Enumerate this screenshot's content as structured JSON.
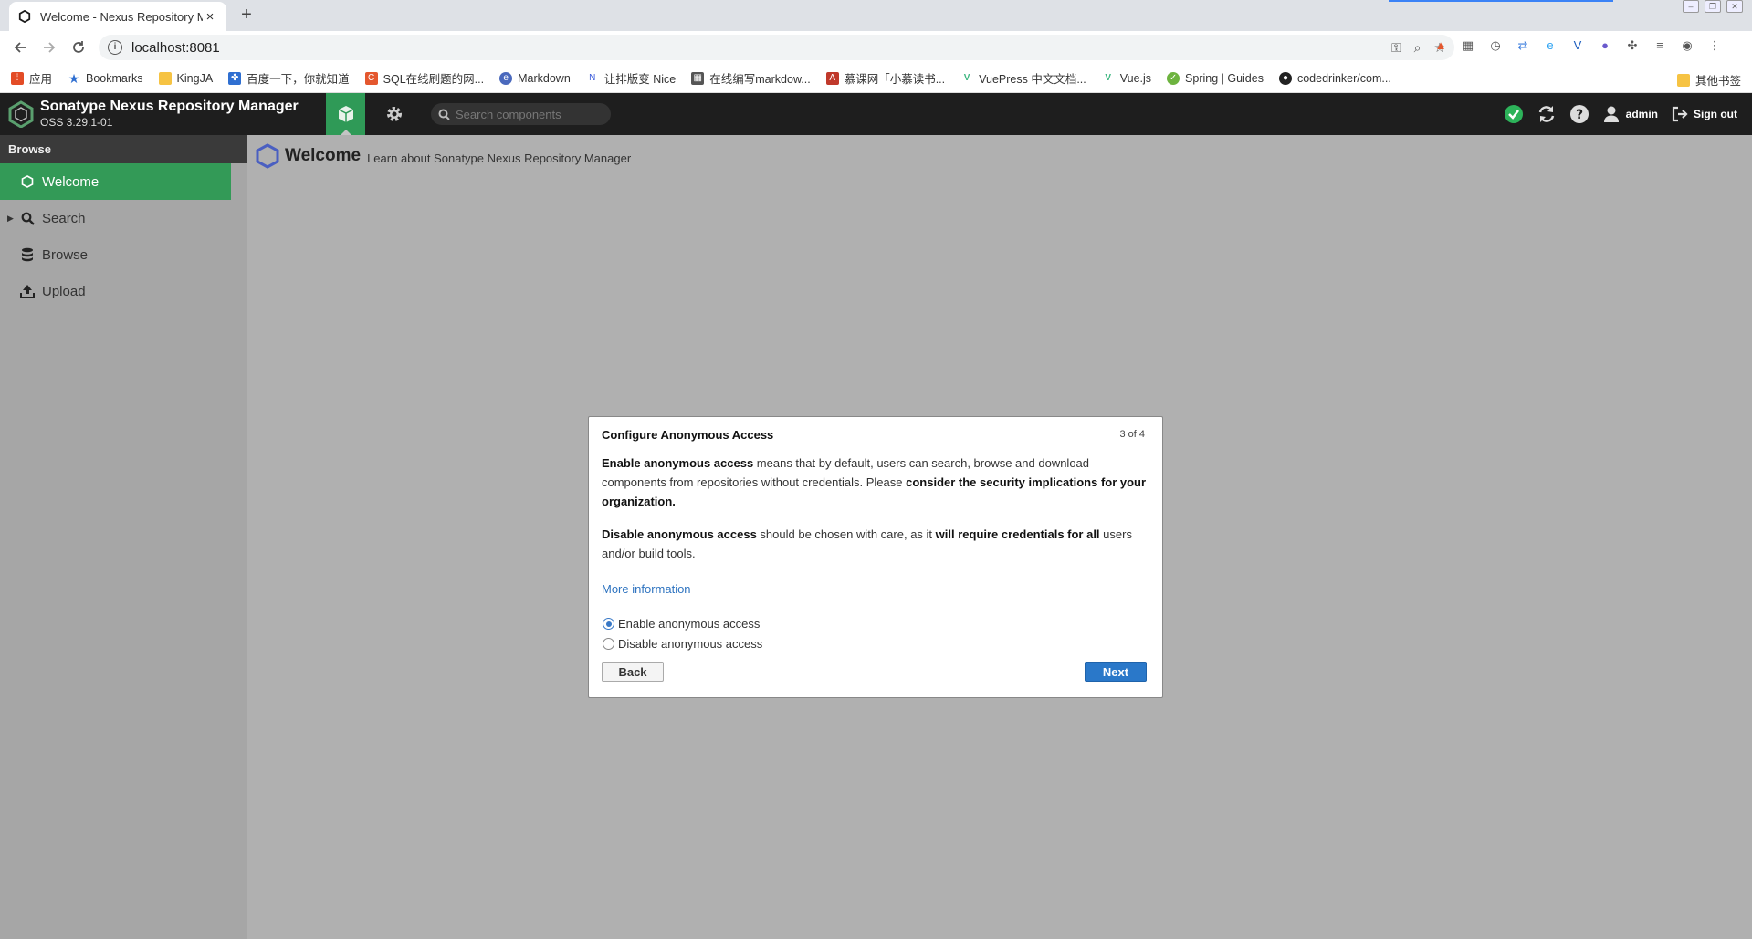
{
  "browser": {
    "tab_title": "Welcome - Nexus Repository M",
    "new_tab_label": "+",
    "tab_close_label": "×",
    "url": "localhost:8081",
    "bookmarks": [
      {
        "label": "应用",
        "icon": "apps-icon",
        "color": "#e34c26"
      },
      {
        "label": "Bookmarks",
        "icon": "star-icon",
        "color": "#2f6fd1"
      },
      {
        "label": "KingJA",
        "icon": "folder-icon",
        "color": "#f6c343"
      },
      {
        "label": "百度一下，你就知道",
        "icon": "baidu-icon",
        "color": "#2f6fd1"
      },
      {
        "label": "SQL在线刷题的网...",
        "icon": "sql-icon",
        "color": "#e4572e"
      },
      {
        "label": "Markdown",
        "icon": "markdown-icon",
        "color": "#4a69bd"
      },
      {
        "label": "让排版变 Nice",
        "icon": "nice-icon",
        "color": "#3b5bdb"
      },
      {
        "label": "在线编写markdow...",
        "icon": "qr-icon",
        "color": "#555555"
      },
      {
        "label": "慕课网「小慕读书...",
        "icon": "imooc-icon",
        "color": "#c0392b"
      },
      {
        "label": "VuePress 中文文档...",
        "icon": "vue-icon",
        "color": "#41b883"
      },
      {
        "label": "Vue.js",
        "icon": "vue-icon",
        "color": "#41b883"
      },
      {
        "label": "Spring | Guides",
        "icon": "spring-icon",
        "color": "#6db33f"
      },
      {
        "label": "codedrinker/com...",
        "icon": "github-icon",
        "color": "#222222"
      }
    ],
    "other_bookmarks": "其他书签"
  },
  "nexus": {
    "product_name": "Sonatype Nexus Repository Manager",
    "version": "OSS 3.29.1-01",
    "search_placeholder": "Search components",
    "user": "admin",
    "sign_out": "Sign out",
    "accent": "#339a57"
  },
  "sidebar": {
    "heading": "Browse",
    "items": [
      {
        "label": "Welcome",
        "icon": "hexagon-icon"
      },
      {
        "label": "Search",
        "icon": "search-icon"
      },
      {
        "label": "Browse",
        "icon": "database-icon"
      },
      {
        "label": "Upload",
        "icon": "upload-icon"
      }
    ]
  },
  "main": {
    "title": "Welcome",
    "subtitle": "Learn about Sonatype Nexus Repository Manager"
  },
  "dialog": {
    "title": "Configure Anonymous Access",
    "step": "3 of 4",
    "p1_b1": "Enable anonymous access",
    "p1_t1": " means that by default, users can search, browse and download components from repositories without credentials. Please ",
    "p1_b2": "consider the security implications for your organization.",
    "p2_b1": "Disable anonymous access",
    "p2_t1": " should be chosen with care, as it ",
    "p2_b2": "will require credentials for all",
    "p2_t2": " users and/or build tools.",
    "more_info": "More information",
    "radio_enable": "Enable anonymous access",
    "radio_disable": "Disable anonymous access",
    "selected": "enable",
    "back_label": "Back",
    "next_label": "Next"
  }
}
